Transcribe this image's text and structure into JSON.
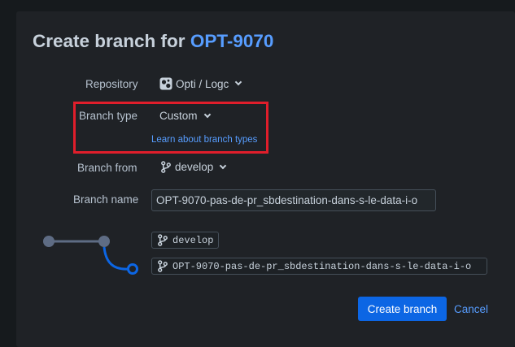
{
  "title": {
    "prefix": "Create branch for ",
    "issue_key": "OPT-9070"
  },
  "form": {
    "repository": {
      "label": "Repository",
      "value": "Opti / Logc"
    },
    "branch_type": {
      "label": "Branch type",
      "value": "Custom",
      "help_link": "Learn about branch types"
    },
    "branch_from": {
      "label": "Branch from",
      "value": "develop"
    },
    "branch_name": {
      "label": "Branch name",
      "value": "OPT-9070-pas-de-pr_sbdestination-dans-s-le-data-i-o"
    }
  },
  "preview": {
    "source_branch": "develop",
    "new_branch": "OPT-9070-pas-de-pr_sbdestination-dans-s-le-data-i-o"
  },
  "actions": {
    "create_label": "Create branch",
    "cancel_label": "Cancel"
  },
  "colors": {
    "accent": "#579dff",
    "primary_button": "#0c66e4",
    "highlight_border": "#e01e2b",
    "graph_main": "#5e6c84",
    "graph_branch": "#0c66e4"
  },
  "icons": {
    "repository": "repository-icon",
    "branch": "git-branch-icon",
    "dropdown": "chevron-down-icon"
  }
}
